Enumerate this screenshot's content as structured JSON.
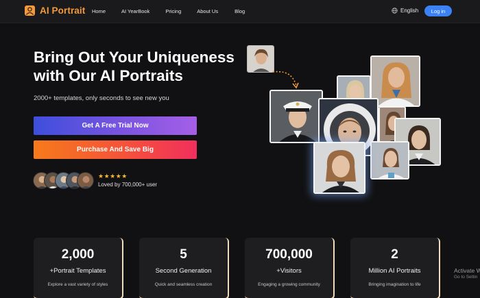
{
  "brand": {
    "name": "AI Portrait",
    "accent": "#f39a3c"
  },
  "nav": {
    "links": [
      "Home",
      "AI YearBook",
      "Pricing",
      "About Us",
      "Blog"
    ],
    "language": "English",
    "login": "Log in"
  },
  "hero": {
    "title": "Bring Out Your Uniqueness with Our AI Portraits",
    "subtitle": "2000+ templates, only seconds to see new you",
    "cta_trial": "Get A Free Trial Now",
    "cta_buy": "Purchase And Save Big",
    "stars": "★★★★★",
    "loved": "Loved by 700,000+ user"
  },
  "stats": [
    {
      "number": "2,000",
      "label": "+Portrait Templates",
      "desc": "Explore a vast variety of styles"
    },
    {
      "number": "5",
      "label": "Second Generation",
      "desc": "Quick and seamless creation"
    },
    {
      "number": "700,000",
      "label": "+Visitors",
      "desc": "Engaging a growing community"
    },
    {
      "number": "2",
      "label": "Million AI Portraits",
      "desc": "Bringing imagination to life"
    }
  ],
  "watermark": {
    "line1": "Activate W",
    "line2": "Go to Settin"
  },
  "colors": {
    "trial_gradient": [
      "#3d4fdc",
      "#a55fe6"
    ],
    "buy_gradient": [
      "#f77a1b",
      "#f12f5c"
    ],
    "login": "#3b82f6"
  }
}
